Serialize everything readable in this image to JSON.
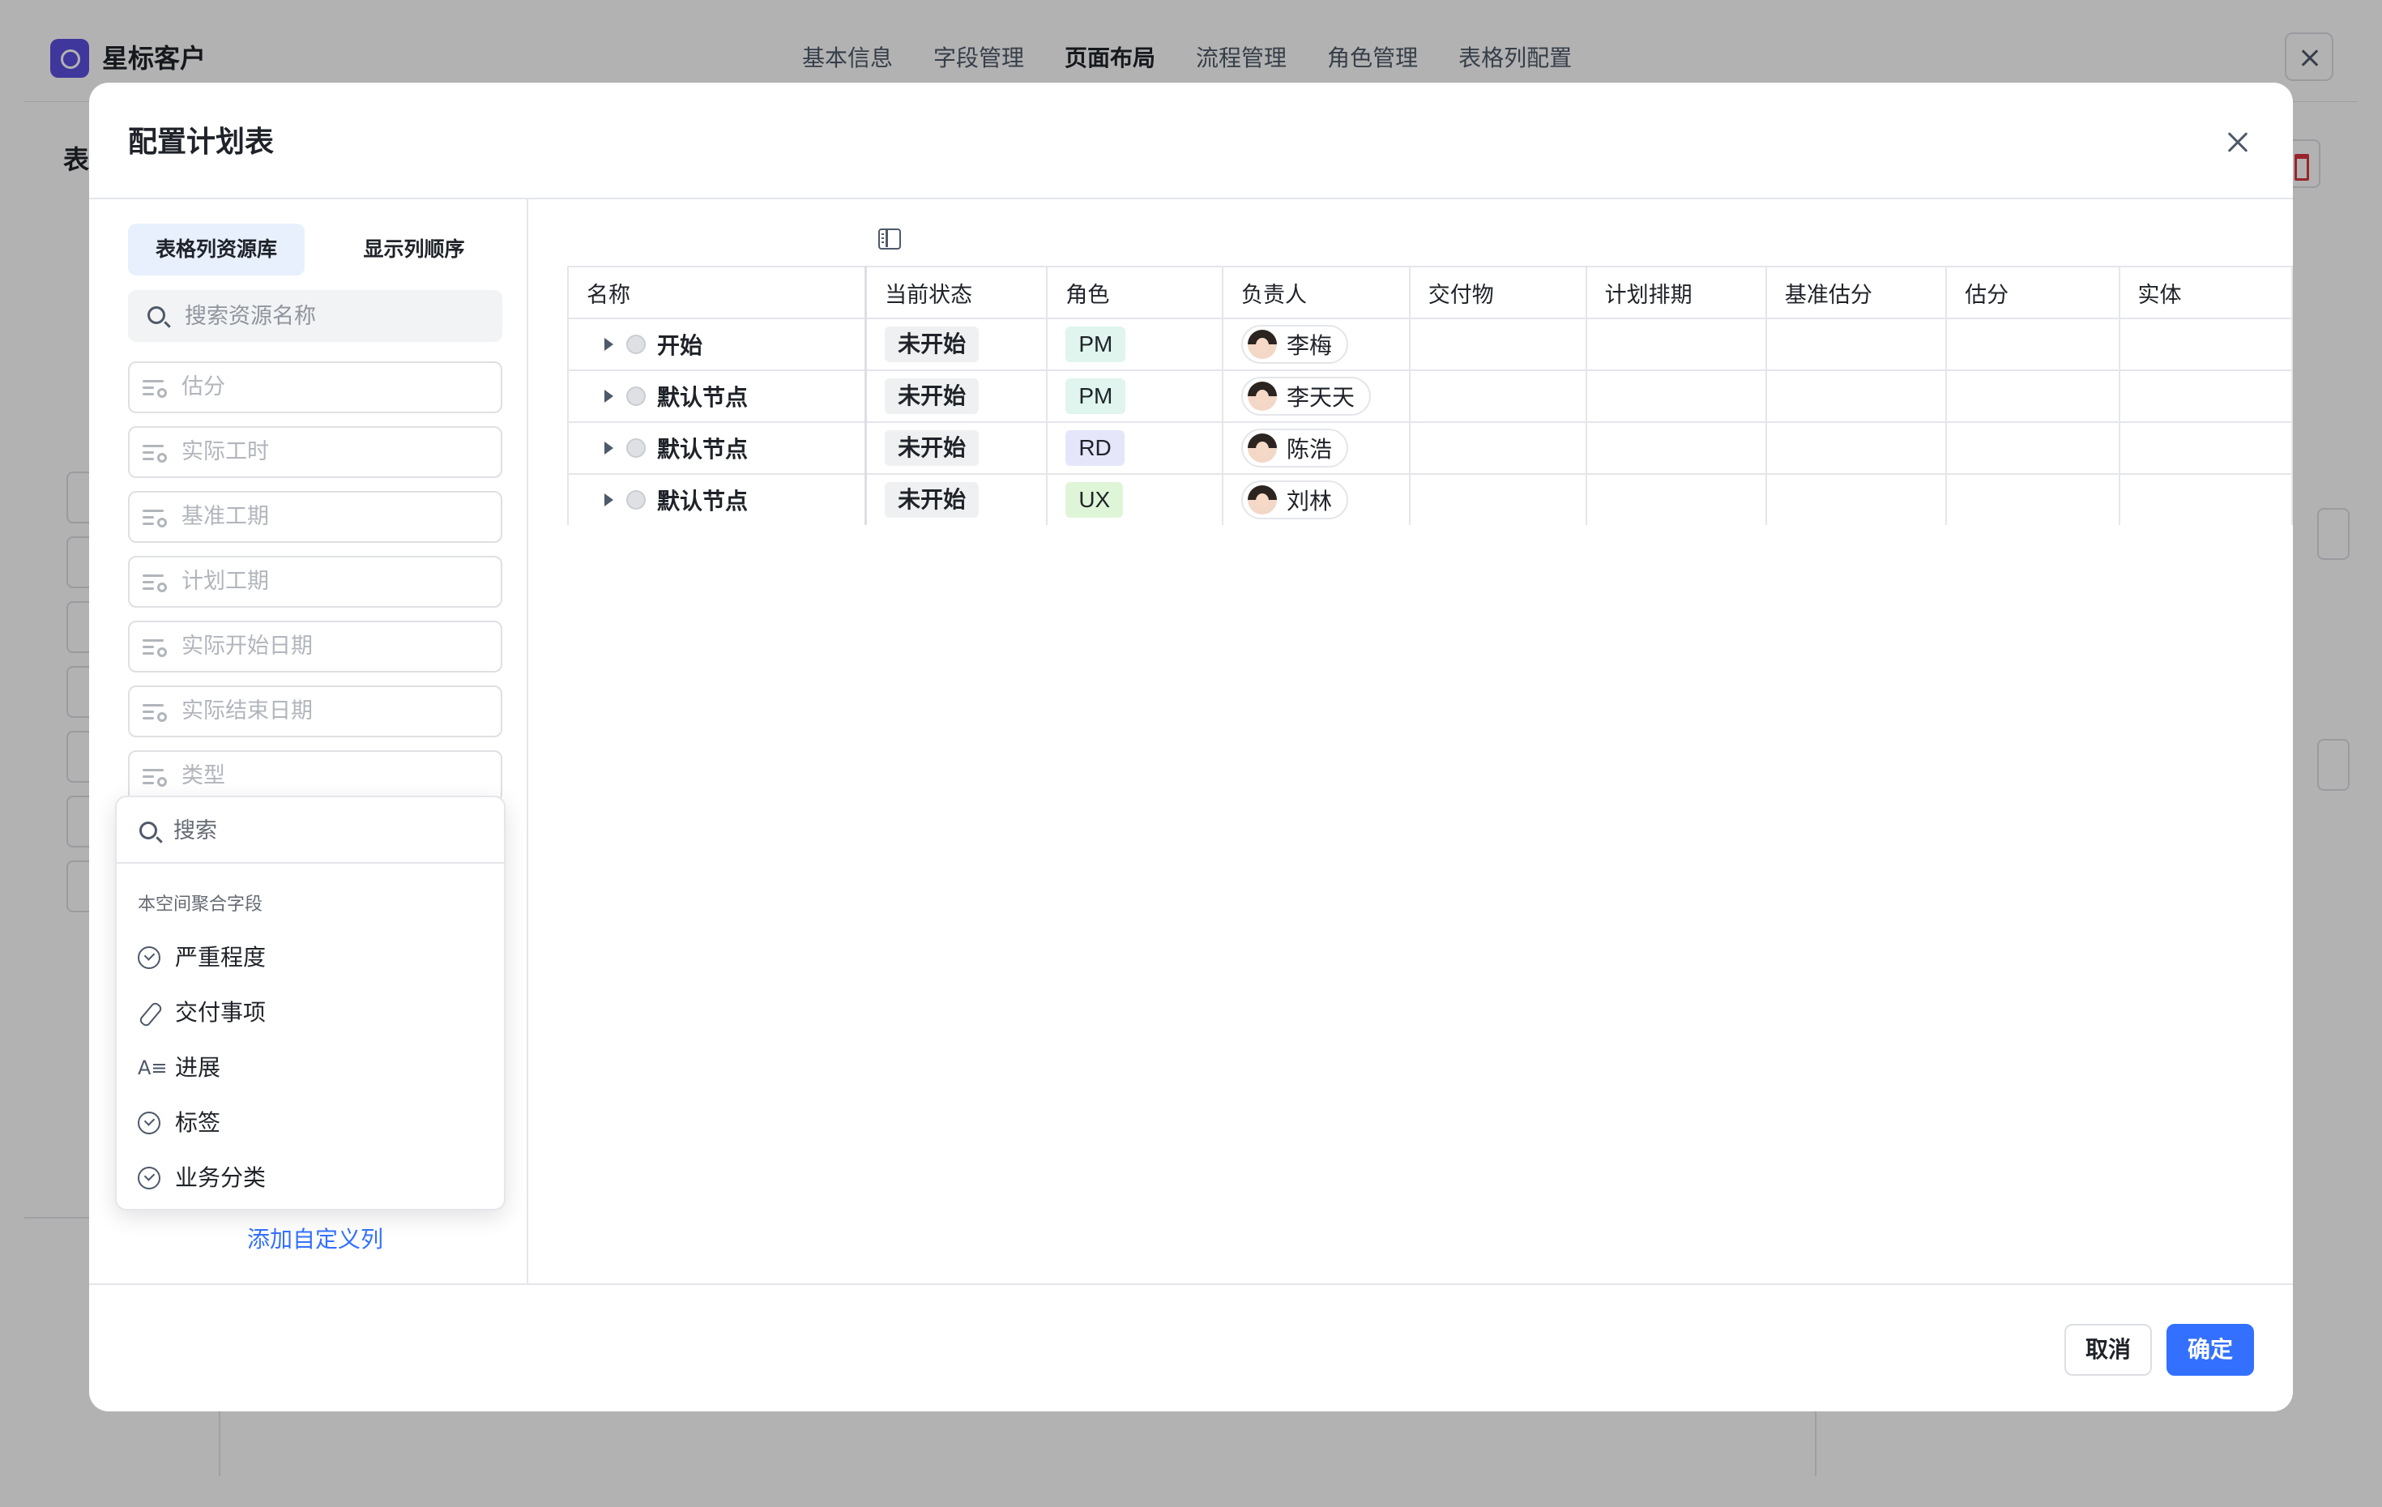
{
  "app": {
    "title": "星标客户",
    "nav": [
      "基本信息",
      "字段管理",
      "页面布局",
      "流程管理",
      "角色管理",
      "表格列配置"
    ],
    "active_nav_index": 2,
    "bg_left_title": "表"
  },
  "modal": {
    "title": "配置计划表",
    "tabs": [
      "表格列资源库",
      "显示列顺序"
    ],
    "active_tab_index": 0,
    "search_placeholder": "搜索资源名称",
    "resources": [
      "估分",
      "实际工时",
      "基准工期",
      "计划工期",
      "实际开始日期",
      "实际结束日期",
      "类型"
    ],
    "dropdown": {
      "search_placeholder": "搜索",
      "group_title": "本空间聚合字段",
      "items": [
        {
          "label": "严重程度",
          "icon": "check-circle-icon"
        },
        {
          "label": "交付事项",
          "icon": "paperclip-icon"
        },
        {
          "label": "进展",
          "icon": "text-icon"
        },
        {
          "label": "标签",
          "icon": "check-circle-icon"
        },
        {
          "label": "业务分类",
          "icon": "check-circle-icon"
        }
      ]
    },
    "add_custom_column": "添加自定义列",
    "table": {
      "columns": [
        "名称",
        "当前状态",
        "角色",
        "负责人",
        "交付物",
        "计划排期",
        "基准估分",
        "估分",
        "实体"
      ],
      "rows": [
        {
          "name": "开始",
          "status": "未开始",
          "role": "PM",
          "owner": "李梅"
        },
        {
          "name": "默认节点",
          "status": "未开始",
          "role": "PM",
          "owner": "李天天"
        },
        {
          "name": "默认节点",
          "status": "未开始",
          "role": "RD",
          "owner": "陈浩"
        },
        {
          "name": "默认节点",
          "status": "未开始",
          "role": "UX",
          "owner": "刘林"
        }
      ]
    },
    "cancel_label": "取消",
    "confirm_label": "确定"
  },
  "colors": {
    "primary": "#3370ff",
    "role_pm": "#dff5ee",
    "role_rd": "#e5e6fa",
    "role_ux": "#dff5d8"
  }
}
